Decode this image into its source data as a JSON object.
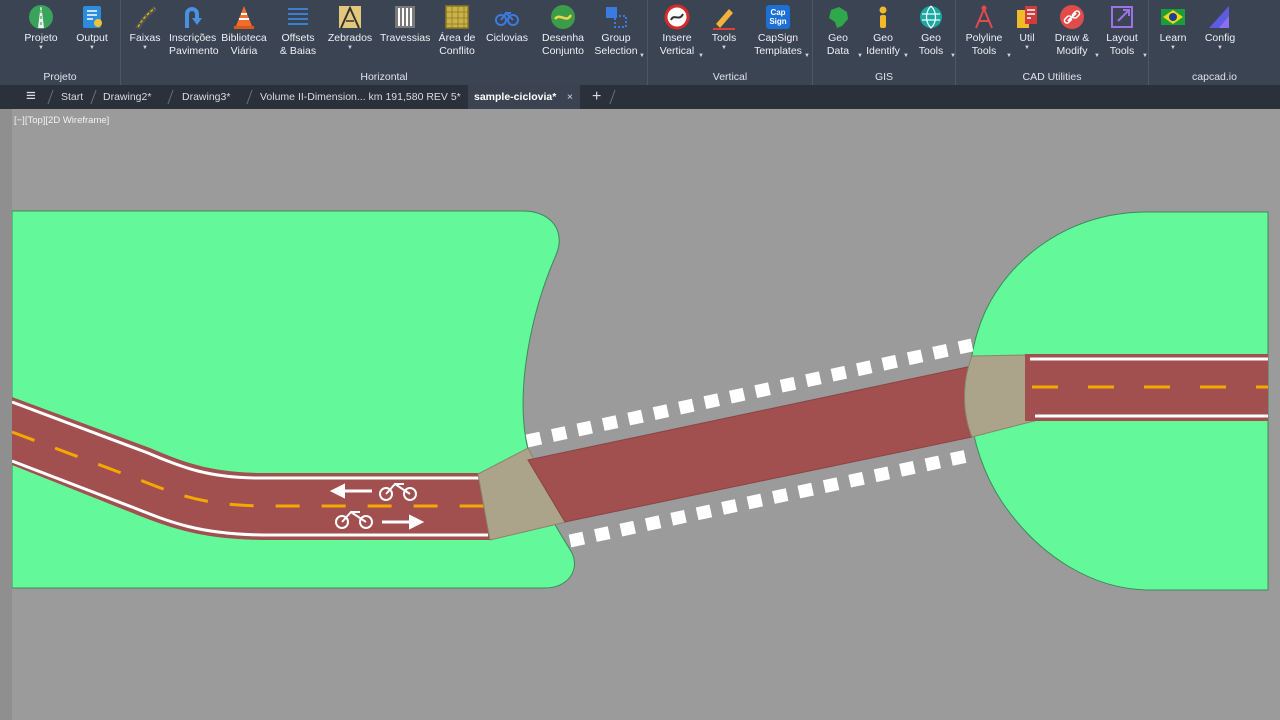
{
  "ribbon": {
    "tools": [
      {
        "label": "Projeto",
        "icon": "road-icon",
        "dropdown": true
      },
      {
        "label": "Output",
        "icon": "output-icon",
        "dropdown": true
      },
      {
        "label": "Faixas",
        "icon": "lanes-icon",
        "dropdown": true
      },
      {
        "label": "Inscrições\nPavimento",
        "icon": "u-turn-icon",
        "dropdown": false
      },
      {
        "label": "Biblioteca\nViária",
        "icon": "traffic-cone-icon",
        "dropdown": false
      },
      {
        "label": "Offsets\n& Baias",
        "icon": "offset-lines-icon",
        "dropdown": false
      },
      {
        "label": "Zebrados",
        "icon": "hatch-icon",
        "dropdown": true
      },
      {
        "label": "Travessias",
        "icon": "crosswalk-icon",
        "dropdown": false
      },
      {
        "label": "Área de\nConflito",
        "icon": "conflict-area-icon",
        "dropdown": false
      },
      {
        "label": "Ciclovias",
        "icon": "bicycle-icon",
        "dropdown": false
      },
      {
        "label": "Desenha\nConjunto",
        "icon": "draw-set-icon",
        "dropdown": false
      },
      {
        "label": "Group\nSelection",
        "icon": "group-selection-icon",
        "dropdown": true
      },
      {
        "label": "Insere\nVertical",
        "icon": "sign-icon",
        "dropdown": true
      },
      {
        "label": "Tools",
        "icon": "pencil-icon",
        "dropdown": true
      },
      {
        "label": "CapSign\nTemplates",
        "icon": "capsign-icon",
        "dropdown": true
      },
      {
        "label": "Geo\nData",
        "icon": "brazil-map-icon",
        "dropdown": true
      },
      {
        "label": "Geo\nIdentify",
        "icon": "identify-icon",
        "dropdown": true
      },
      {
        "label": "Geo\nTools",
        "icon": "globe-icon",
        "dropdown": true
      },
      {
        "label": "Polyline\nTools",
        "icon": "compass-icon",
        "dropdown": true
      },
      {
        "label": "Util",
        "icon": "calculator-icon",
        "dropdown": true
      },
      {
        "label": "Draw &\nModify",
        "icon": "link-icon",
        "dropdown": true
      },
      {
        "label": "Layout\nTools",
        "icon": "layout-icon",
        "dropdown": true
      },
      {
        "label": "Learn",
        "icon": "brazil-flag-icon",
        "dropdown": true
      },
      {
        "label": "Config",
        "icon": "config-icon",
        "dropdown": true
      }
    ],
    "panels": [
      "Projeto",
      "Horizontal",
      "Vertical",
      "GIS",
      "CAD Utilities",
      "capcad.io"
    ]
  },
  "tabs": {
    "items": [
      {
        "label": "Start",
        "active": false
      },
      {
        "label": "Drawing2*",
        "active": false
      },
      {
        "label": "Drawing3*",
        "active": false
      },
      {
        "label": "Volume II-Dimension... km 191,580 REV 5*",
        "active": false
      },
      {
        "label": "sample-ciclovia*",
        "active": true
      }
    ],
    "close_glyph": "×",
    "new_tab_glyph": "+",
    "menu_glyph": "≡"
  },
  "viewport": {
    "view_label": "[−][Top][2D Wireframe]"
  },
  "colors": {
    "ribbon_bg": "#3b4453",
    "canvas_bg": "#9b9b9b",
    "grass": "#63f99b",
    "bikelane": "#a14f4f",
    "center_dash": "#f5a800",
    "ramp": "#aba48a"
  }
}
